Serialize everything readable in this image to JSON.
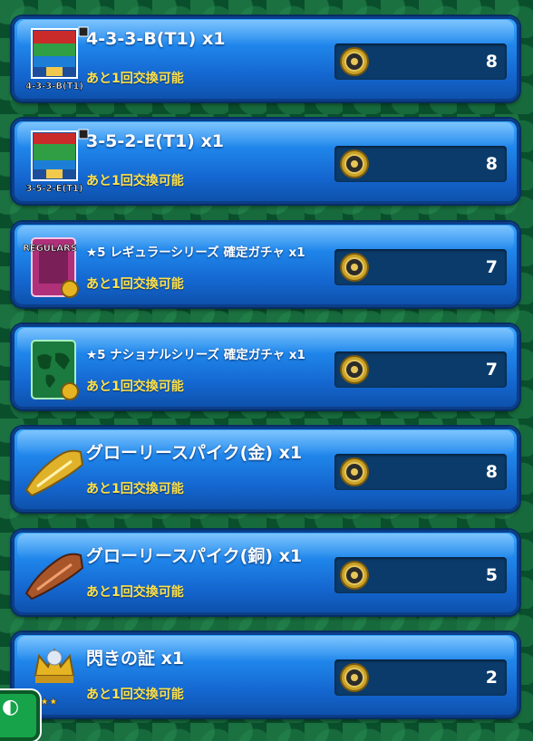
{
  "items": [
    {
      "name": "4-3-3-B(T1) x1",
      "remain": "あと1回交換可能",
      "cost": "8",
      "icon": "formation-icon",
      "badge": "4-3-3-B(T1)"
    },
    {
      "name": "3-5-2-E(T1) x1",
      "remain": "あと1回交換可能",
      "cost": "8",
      "icon": "formation-icon",
      "badge": "3-5-2-E(T1)"
    },
    {
      "name": "★5 レギュラーシリーズ 確定ガチャ x1",
      "remain": "あと1回交換可能",
      "cost": "7",
      "icon": "regulars-gacha-icon",
      "badge": "REGULARS"
    },
    {
      "name": "★5 ナショナルシリーズ 確定ガチャ x1",
      "remain": "あと1回交換可能",
      "cost": "7",
      "icon": "national-gacha-icon",
      "badge": ""
    },
    {
      "name": "グローリースパイク(金) x1",
      "remain": "あと1回交換可能",
      "cost": "8",
      "icon": "gold-spike-icon",
      "badge": ""
    },
    {
      "name": "グローリースパイク(銅) x1",
      "remain": "あと1回交換可能",
      "cost": "5",
      "icon": "bronze-spike-icon",
      "badge": ""
    },
    {
      "name": "閃きの証 x1",
      "remain": "あと1回交換可能",
      "cost": "2",
      "icon": "crown-icon",
      "badge": "★★★"
    }
  ],
  "currency_icon": "medal-coin-icon",
  "colors": {
    "card": "#1f85ea",
    "remain_text": "#ffe24a",
    "cost_box": "#0b3b6a",
    "background": "#0a4f2c"
  }
}
